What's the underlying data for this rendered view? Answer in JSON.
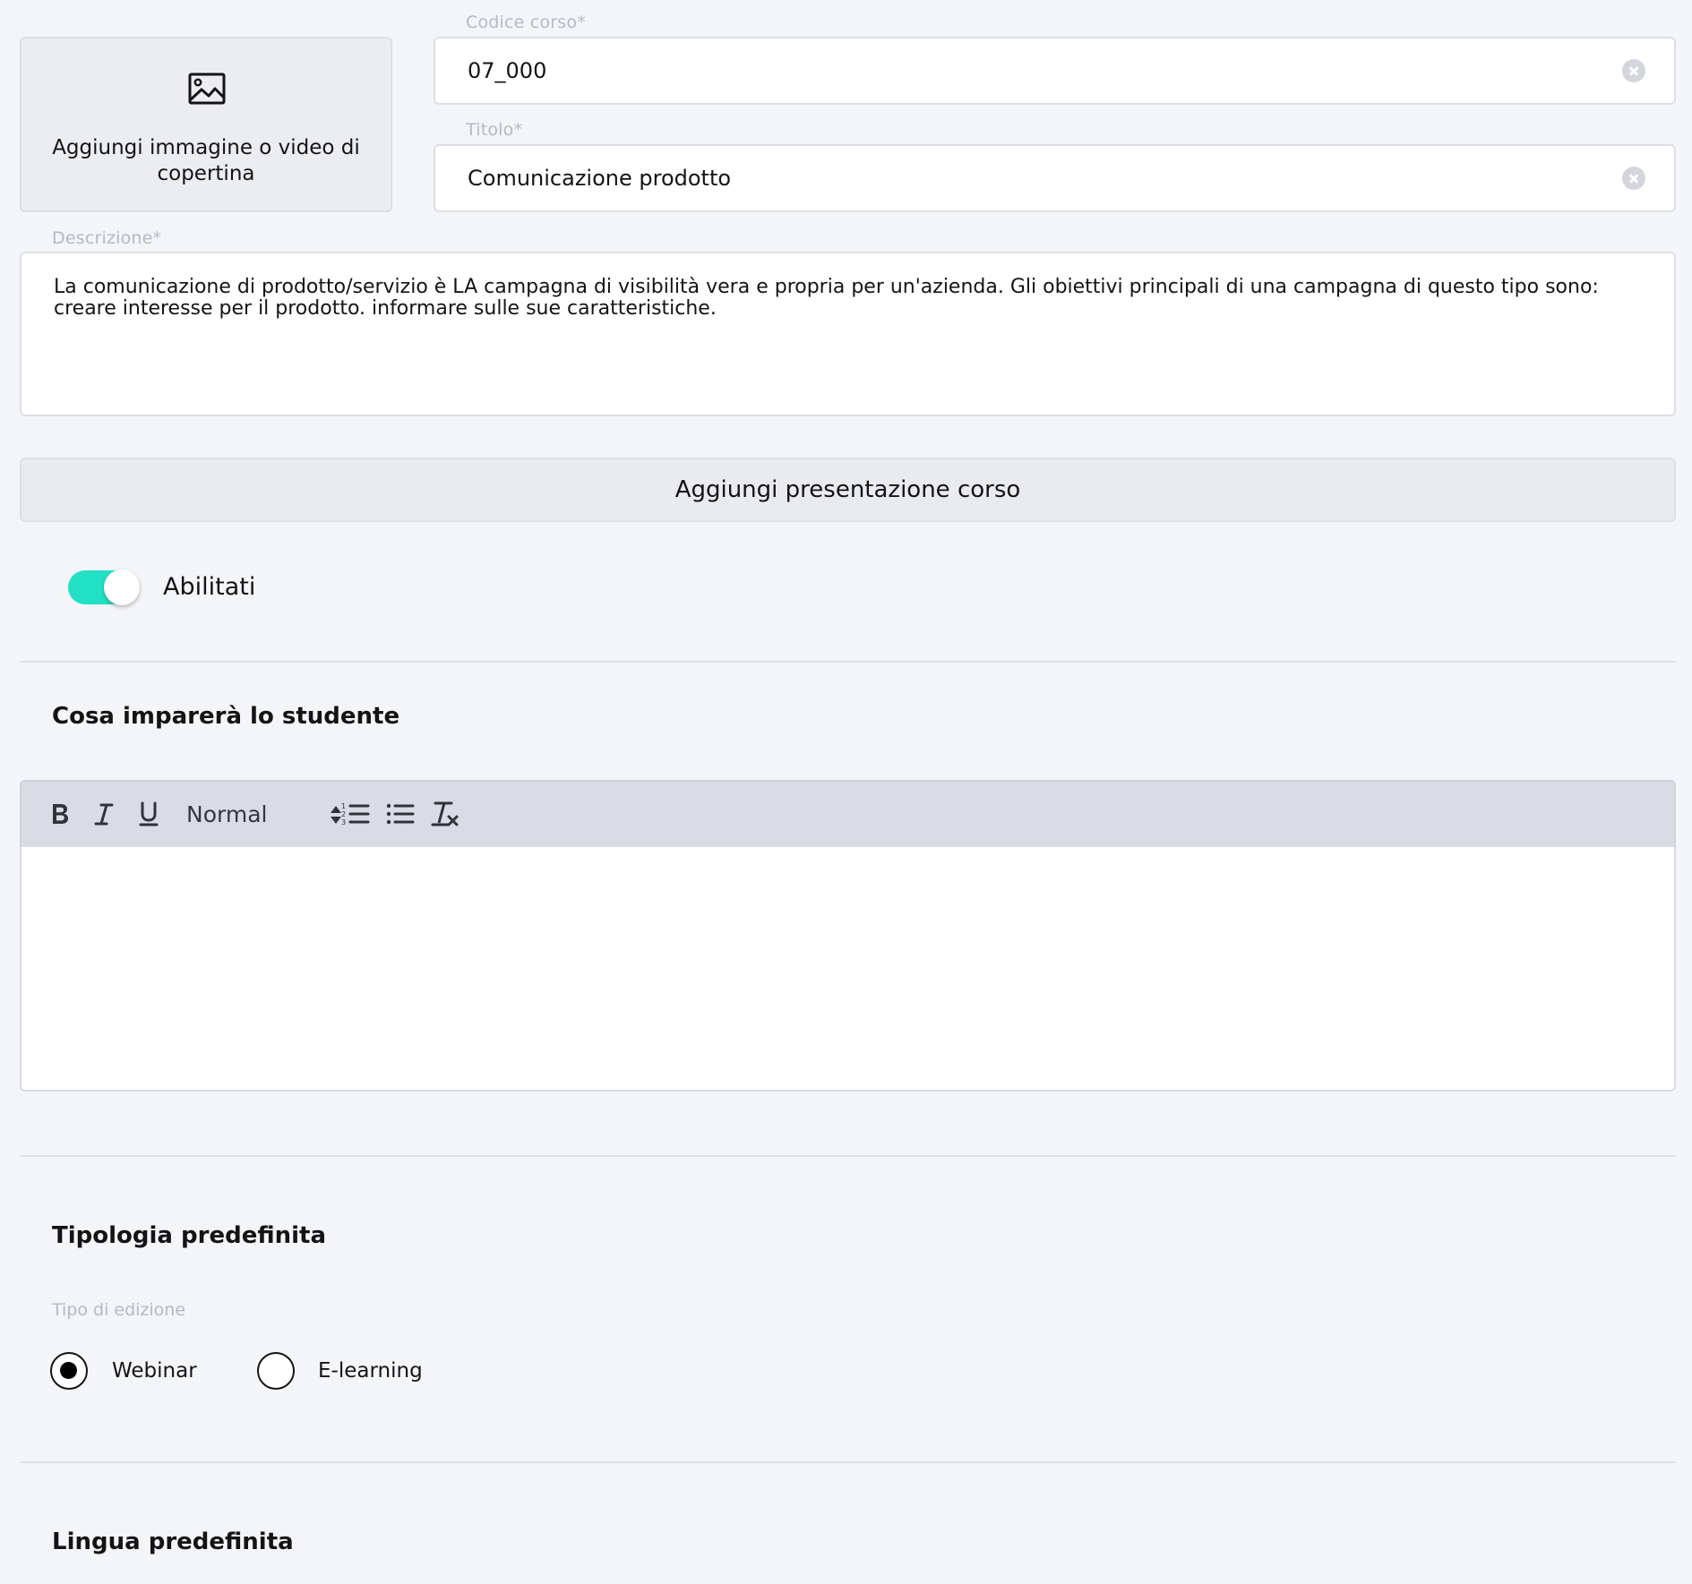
{
  "course_code": {
    "label": "Codice corso*",
    "value": "07_000"
  },
  "title_field": {
    "label": "Titolo*",
    "value": "Comunicazione prodotto"
  },
  "cover": {
    "label": "Aggiungi immagine o video di copertina",
    "icon": "image-icon"
  },
  "description": {
    "label": "Descrizione*",
    "value": "La comunicazione di prodotto/servizio è LA campagna di visibilità vera e propria per un'azienda. Gli obiettivi principali di una campagna di questo tipo sono: creare interesse per il prodotto. informare sulle sue caratteristiche."
  },
  "presentation_button": {
    "label": "Aggiungi presentazione corso"
  },
  "enabled_toggle": {
    "label": "Abilitati",
    "on": true,
    "color": "#22e0c4"
  },
  "learning_section": {
    "title": "Cosa imparerà lo studente",
    "editor": {
      "format_select": "Normal",
      "tools": [
        "bold-icon",
        "italic-icon",
        "underline-icon",
        "ordered-list-icon",
        "bullet-list-icon",
        "clear-format-icon"
      ],
      "content": ""
    }
  },
  "type_section": {
    "title": "Tipologia predefinita",
    "label": "Tipo di edizione",
    "options": [
      {
        "label": "Webinar",
        "selected": true
      },
      {
        "label": "E-learning",
        "selected": false
      }
    ]
  },
  "language_section": {
    "title": "Lingua predefinita"
  },
  "colors": {
    "background": "#f4f5f9",
    "accent": "#22e0c4",
    "toolbar": "#d9dce4"
  }
}
